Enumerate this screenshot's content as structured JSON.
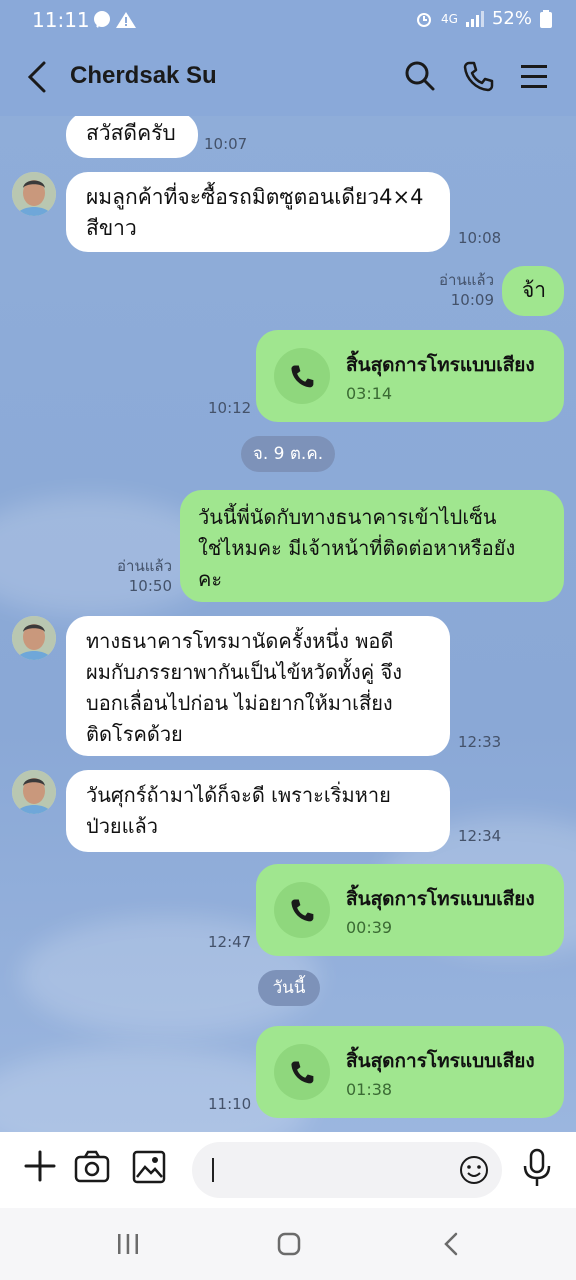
{
  "status": {
    "time": "11:11",
    "network": "4G",
    "battery": "52%"
  },
  "header": {
    "contact_name": "Cherdsak Su"
  },
  "messages": [
    {
      "side": "in",
      "text": "สวัสดีครับ",
      "time": "10:07"
    },
    {
      "side": "in",
      "text": "ผมลูกค้าที่จะซื้อรถมิตซูตอนเดียว4×4 สีขาว",
      "line1": "ผมลูกค้าที่จะซื้อรถมิตซูตอนเดียว4×4",
      "line2": "สีขาว",
      "time": "10:08"
    },
    {
      "side": "out",
      "text": "จ้า",
      "read": "อ่านแล้ว",
      "time": "10:09"
    },
    {
      "side": "out",
      "type": "call",
      "title": "สิ้นสุดการโทรแบบเสียง",
      "duration": "03:14",
      "time": "10:12"
    },
    {
      "side": "out",
      "line1": "วันนี้พี่นัดกับทางธนาคารเข้าไปเซ็น",
      "line2": "ใช่ไหมคะ มีเจ้าหน้าที่ติดต่อหาหรือยัง",
      "line3": "คะ",
      "read": "อ่านแล้ว",
      "time": "10:50"
    },
    {
      "side": "in",
      "line1": "ทางธนาคารโทรมานัดครั้งหนึ่ง พอดี",
      "line2": "ผมกับภรรยาพากันเป็นไข้หวัดทั้งคู่ จึง",
      "line3": "บอกเลื่อนไปก่อน ไม่อยากให้มาเสี่ยง",
      "line4": "ติดโรคด้วย",
      "time": "12:33"
    },
    {
      "side": "in",
      "line1": "วันศุกร์ถ้ามาได้ก็จะดี เพราะเริ่มหาย",
      "line2": "ป่วยแล้ว",
      "time": "12:34"
    },
    {
      "side": "out",
      "type": "call",
      "title": "สิ้นสุดการโทรแบบเสียง",
      "duration": "00:39",
      "time": "12:47"
    },
    {
      "side": "out",
      "type": "call",
      "title": "สิ้นสุดการโทรแบบเสียง",
      "duration": "01:38",
      "time": "11:10"
    }
  ],
  "date_dividers": {
    "first": "จ. 9 ต.ค.",
    "second": "วันนี้"
  },
  "colors": {
    "chat_bg": "#8aa9d9",
    "outgoing": "#a0e68f",
    "incoming": "#ffffff"
  }
}
